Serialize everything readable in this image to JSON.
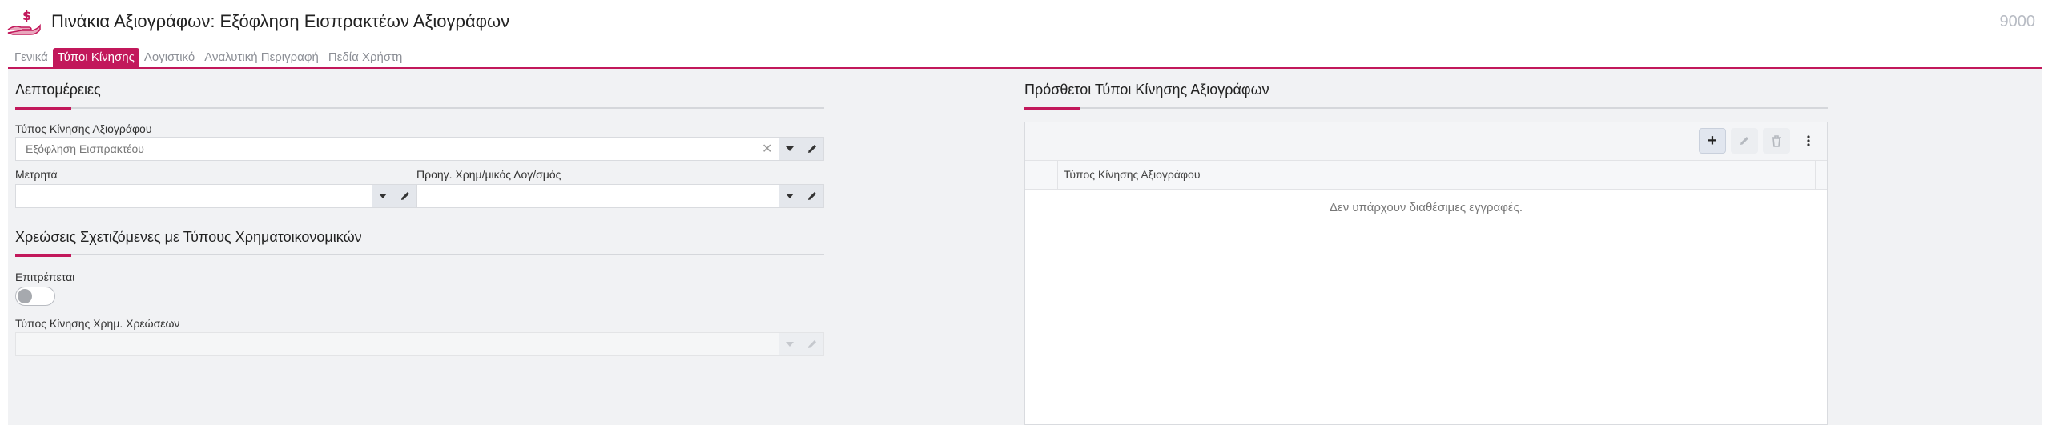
{
  "header": {
    "title": "Πινάκια Αξιογράφων: Εξόφληση Εισπρακτέων Αξιογράφων",
    "record_id": "9000",
    "icon": "hand-money-icon"
  },
  "tabs": [
    {
      "label": "Γενικά",
      "active": false
    },
    {
      "label": "Τύποι Κίνησης",
      "active": true
    },
    {
      "label": "Λογιστικό",
      "active": false
    },
    {
      "label": "Αναλυτική Περιγραφή",
      "active": false
    },
    {
      "label": "Πεδία Χρήστη",
      "active": false
    }
  ],
  "details": {
    "title": "Λεπτομέρειες",
    "movement_type": {
      "label": "Τύπος Κίνησης Αξιογράφου",
      "value": "Εξόφληση Εισπρακτέου"
    },
    "counter": {
      "label": "Μετρητά",
      "value": ""
    },
    "prev_account": {
      "label": "Προηγ. Χρημ/μικός Λογ/σμός",
      "value": ""
    }
  },
  "charges": {
    "title": "Χρεώσεις Σχετιζόμενες με Τύπους Χρηματοικονομικών",
    "allowed_label": "Επιτρέπεται",
    "allowed": false,
    "charge_type": {
      "label": "Τύπος Κίνησης Χρημ. Χρεώσεων",
      "value": ""
    }
  },
  "additional": {
    "title": "Πρόσθετοι Τύποι Κίνησης Αξιογράφων",
    "column_header": "Τύπος Κίνησης Αξιογράφου",
    "empty_message": "Δεν υπάρχουν διαθέσιμες εγγραφές.",
    "toolbar": {
      "add": "+"
    }
  },
  "colors": {
    "accent": "#c2185b",
    "background": "#f1f2f4"
  }
}
